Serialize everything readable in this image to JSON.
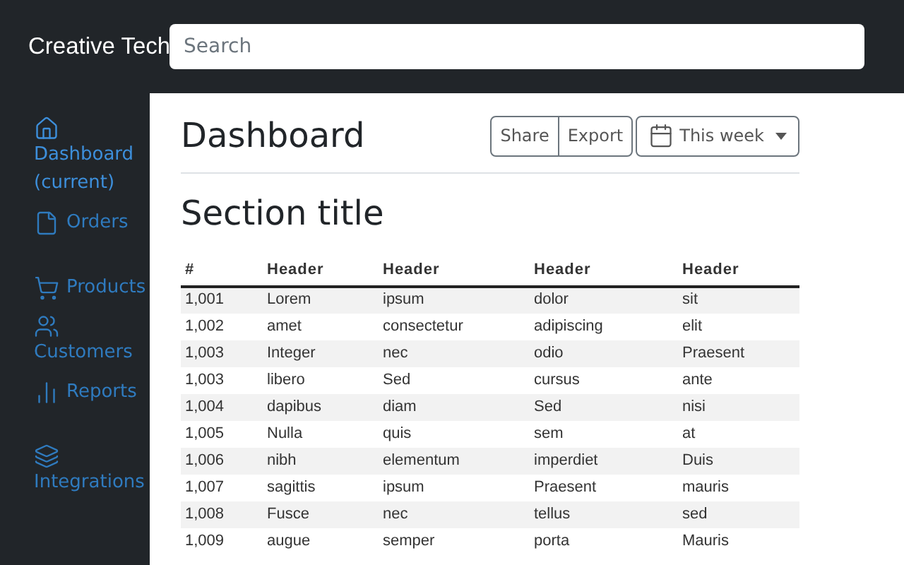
{
  "navbar": {
    "brand": "Creative Tech",
    "search": {
      "placeholder": "Search"
    }
  },
  "sidebar": {
    "items": [
      {
        "label": "Dashboard (current)",
        "selected": true
      },
      {
        "label": "Orders",
        "selected": false
      },
      {
        "label": "Products",
        "selected": false
      },
      {
        "label": "Customers",
        "selected": false
      },
      {
        "label": "Reports",
        "selected": false
      },
      {
        "label": "Integrations",
        "selected": false
      }
    ]
  },
  "page": {
    "title": "Dashboard",
    "buttons": [
      "Share",
      "Export"
    ],
    "period": {
      "label": "This week"
    }
  },
  "section": {
    "title": "Section title"
  },
  "table": {
    "columns": [
      "#",
      "Header",
      "Header",
      "Header",
      "Header"
    ],
    "rows": [
      [
        "1,001",
        "Lorem",
        "ipsum",
        "dolor",
        "sit"
      ],
      [
        "1,002",
        "amet",
        "consectetur",
        "adipiscing",
        "elit"
      ],
      [
        "1,003",
        "Integer",
        "nec",
        "odio",
        "Praesent"
      ],
      [
        "1,003",
        "libero",
        "Sed",
        "cursus",
        "ante"
      ],
      [
        "1,004",
        "dapibus",
        "diam",
        "Sed",
        "nisi"
      ],
      [
        "1,005",
        "Nulla",
        "quis",
        "sem",
        "at"
      ],
      [
        "1,006",
        "nibh",
        "elementum",
        "imperdiet",
        "Duis"
      ],
      [
        "1,007",
        "sagittis",
        "ipsum",
        "Praesent",
        "mauris"
      ],
      [
        "1,008",
        "Fusce",
        "nec",
        "tellus",
        "sed"
      ],
      [
        "1,009",
        "augue",
        "semper",
        "porta",
        "Mauris"
      ]
    ]
  }
}
